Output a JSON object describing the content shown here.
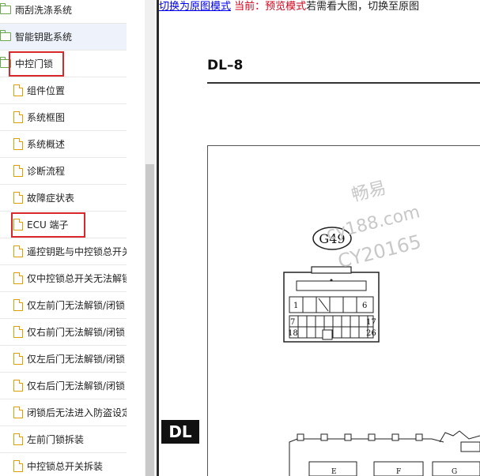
{
  "tree": {
    "items": [
      {
        "label": "雨刮洗涤系统",
        "type": "folder",
        "level": 0
      },
      {
        "label": "智能钥匙系统",
        "type": "folder",
        "level": 0,
        "highlighted": true
      },
      {
        "label": "中控门锁",
        "type": "folder",
        "level": 0,
        "boxed": true
      },
      {
        "label": "组件位置",
        "type": "page",
        "level": 1
      },
      {
        "label": "系统框图",
        "type": "page",
        "level": 1
      },
      {
        "label": "系统概述",
        "type": "page",
        "level": 1
      },
      {
        "label": "诊断流程",
        "type": "page",
        "level": 1
      },
      {
        "label": "故障症状表",
        "type": "page",
        "level": 1
      },
      {
        "label": "ECU 端子",
        "type": "page",
        "level": 1,
        "boxed": true
      },
      {
        "label": "遥控钥匙与中控锁总开关",
        "type": "page",
        "level": 1
      },
      {
        "label": "仅中控锁总开关无法解锁",
        "type": "page",
        "level": 1
      },
      {
        "label": "仅左前门无法解锁/闭锁",
        "type": "page",
        "level": 1
      },
      {
        "label": "仅右前门无法解锁/闭锁",
        "type": "page",
        "level": 1
      },
      {
        "label": "仅左后门无法解锁/闭锁",
        "type": "page",
        "level": 1
      },
      {
        "label": "仅右后门无法解锁/闭锁",
        "type": "page",
        "level": 1
      },
      {
        "label": "闭锁后无法进入防盗设定",
        "type": "page",
        "level": 1
      },
      {
        "label": "左前门锁拆装",
        "type": "page",
        "level": 1
      },
      {
        "label": "中控锁总开关拆装",
        "type": "page",
        "level": 1
      }
    ]
  },
  "toolbar": {
    "switch_link": "切换为原图模式",
    "current_mode": "当前：预览模式",
    "tip": "若需看大图，切换至原图"
  },
  "document": {
    "page_code": "DL–8",
    "side_tab": "DL",
    "connector_label": "G49",
    "pin_labels": [
      "1",
      "6",
      "7",
      "17",
      "18",
      "26"
    ],
    "bottom_labels": [
      "E",
      "F",
      "G"
    ],
    "watermark": [
      "畅易",
      "cy188.com",
      "CY20165"
    ]
  },
  "colors": {
    "link": "#0000ee",
    "current_mode": "#d0021b",
    "highlight_box": "#d9272e",
    "folder_icon": "#6aa84f",
    "page_icon": "#e0a000"
  }
}
